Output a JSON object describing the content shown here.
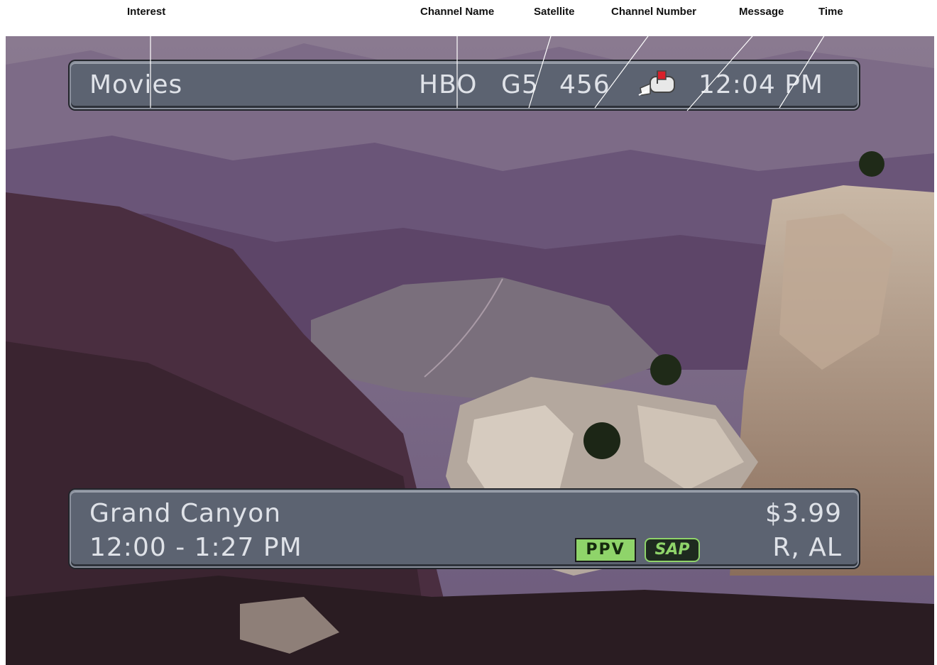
{
  "callouts": {
    "interest": "Interest",
    "channel_name": "Channel Name",
    "satellite": "Satellite",
    "channel_number": "Channel Number",
    "message": "Message",
    "time": "Time"
  },
  "top_bar": {
    "interest": "Movies",
    "channel_name": "HBO",
    "satellite": "G5",
    "channel_number": "456",
    "message_icon": "mailbox-icon",
    "time": "12:04 PM"
  },
  "bottom_bar": {
    "title": "Grand Canyon",
    "time_range": "12:00 - 1:27 PM",
    "price": "$3.99",
    "rating": "R, AL",
    "badges": [
      "PPV",
      "SAP"
    ]
  },
  "colors": {
    "bar": "#5c6371",
    "bar_text": "#dfe2e8",
    "ppv_badge": "#8fd46a",
    "mailbox_flag": "#d8202a"
  }
}
